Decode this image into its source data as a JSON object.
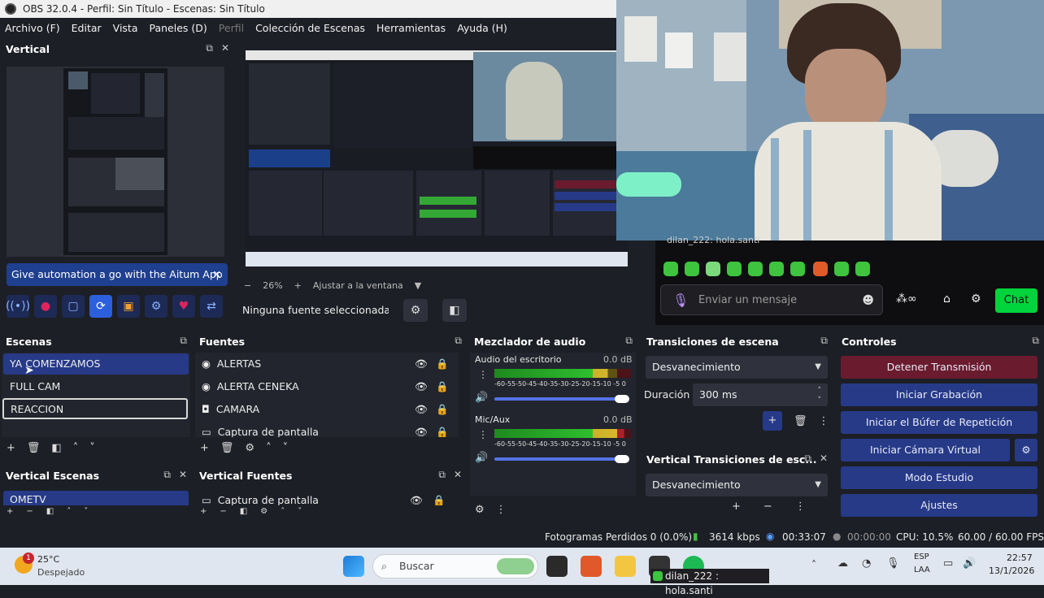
{
  "window": {
    "title": "OBS 32.0.4 - Perfil: Sin Título - Escenas: Sin Título"
  },
  "menu": [
    "Archivo (F)",
    "Editar",
    "Vista",
    "Paneles (D)",
    "Perfil",
    "Colección de Escenas",
    "Herramientas",
    "Ayuda (H)"
  ],
  "vertical_dock": {
    "title": "Vertical",
    "banner": "Give automation a go with the Aitum App"
  },
  "preview": {
    "zoom": "26%",
    "fit": "Ajustar a la ventana",
    "no_source": "Ninguna fuente seleccionada"
  },
  "chat": {
    "top_line": "dilan_222: hola.santi",
    "placeholder": "Enviar un mensaje",
    "send_label": "Chat"
  },
  "scenes": {
    "title": "Escenas",
    "items": [
      "YA COMENZAMOS",
      "FULL CAM",
      "REACCION"
    ]
  },
  "sources": {
    "title": "Fuentes",
    "items": [
      {
        "label": "ALERTAS",
        "icon": "browser-icon"
      },
      {
        "label": "ALERTA CENEKA",
        "icon": "browser-icon"
      },
      {
        "label": "CAMARA",
        "icon": "camera-icon"
      },
      {
        "label": "Captura de pantalla",
        "icon": "monitor-icon"
      }
    ]
  },
  "mixer": {
    "title": "Mezclador de audio",
    "channels": [
      {
        "name": "Audio del escritorio",
        "db": "0.0 dB",
        "level": 0.83
      },
      {
        "name": "Mic/Aux",
        "db": "0.0 dB",
        "level": 0.95
      }
    ],
    "scale": "-60-55-50-45-40-35-30-25-20-15-10 -5 0"
  },
  "transitions": {
    "title": "Transiciones de escena",
    "selected": "Desvanecimiento",
    "duration_label": "Duración",
    "duration_value": "300 ms"
  },
  "vertical_transitions": {
    "title": "Vertical Transiciones de esc...",
    "selected": "Desvanecimiento"
  },
  "controls": {
    "title": "Controles",
    "stop_stream": "Detener Transmisión",
    "start_record": "Iniciar Grabación",
    "replay_buffer": "Iniciar el Búfer de Repetición",
    "virtual_cam": "Iniciar Cámara Virtual",
    "studio_mode": "Modo Estudio",
    "settings": "Ajustes"
  },
  "vertical_scenes": {
    "title": "Vertical Escenas",
    "items": [
      "OMETV"
    ]
  },
  "vertical_sources": {
    "title": "Vertical Fuentes",
    "items": [
      "Captura de pantalla"
    ]
  },
  "status": {
    "dropped": "Fotogramas Perdidos 0 (0.0%)",
    "bitrate": "3614 kbps",
    "stream_time": "00:33:07",
    "record_time": "00:00:00",
    "cpu": "CPU: 10.5%",
    "fps": "60.00 / 60.00 FPS"
  },
  "taskbar": {
    "weather_temp": "25°C",
    "weather_desc": "Despejado",
    "weather_badge": "1",
    "search": "Buscar",
    "lang_top": "ESP",
    "lang_bottom": "LAA",
    "time": "22:57",
    "date": "13/1/2026",
    "chat_overlay": "dilan_222 : hola.santi"
  },
  "colors": {
    "accent_blue": "#263a88",
    "stop_red": "#6b1b2e",
    "chat_green": "#00d33b"
  }
}
